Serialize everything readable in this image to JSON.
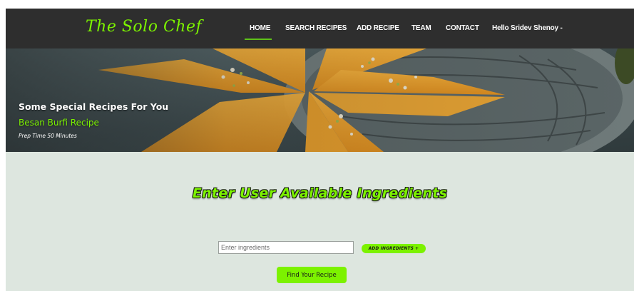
{
  "navbar": {
    "brand": "The Solo Chef",
    "items": [
      {
        "label": "HOME",
        "active": true
      },
      {
        "label": "SEARCH RECIPES"
      },
      {
        "label": "ADD RECIPE"
      },
      {
        "label": "TEAM"
      },
      {
        "label": "CONTACT"
      },
      {
        "label": "Hello Sridev Shenoy -"
      }
    ]
  },
  "hero": {
    "title": "Some Special Recipes For You",
    "recipe_name": "Besan Burfi Recipe",
    "prep_time": "Prep Time 50 Minutes"
  },
  "main": {
    "heading": "Enter User Available Ingredients",
    "ingredients_input": {
      "value": "",
      "placeholder": "Enter ingredients"
    },
    "add_button": "ADD INGREDIENTS +",
    "find_button": "Find Your Recipe"
  },
  "colors": {
    "accent": "#7cf200",
    "navbar_bg": "#2e2e2e",
    "page_bg": "#dde6df"
  }
}
